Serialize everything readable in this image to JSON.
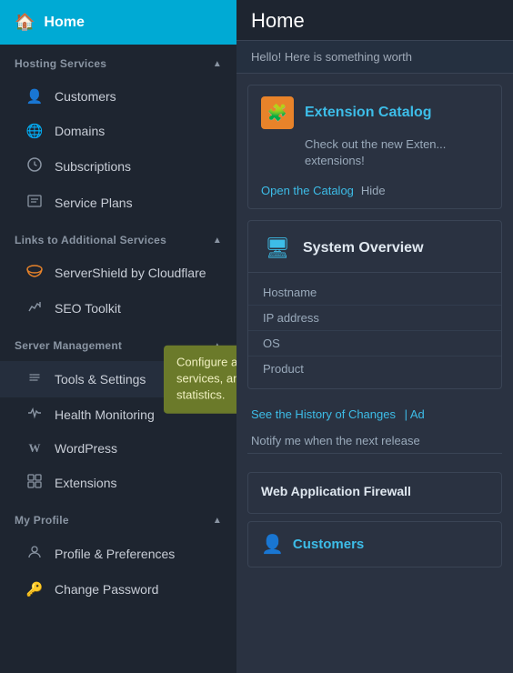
{
  "sidebar": {
    "home_label": "Home",
    "sections": [
      {
        "id": "hosting-services",
        "label": "Hosting Services",
        "items": [
          {
            "id": "customers",
            "label": "Customers",
            "icon": "👤"
          },
          {
            "id": "domains",
            "label": "Domains",
            "icon": "🌐"
          },
          {
            "id": "subscriptions",
            "label": "Subscriptions",
            "icon": "⚙"
          },
          {
            "id": "service-plans",
            "label": "Service Plans",
            "icon": "📋"
          }
        ]
      },
      {
        "id": "links-additional",
        "label": "Links to Additional Services",
        "items": [
          {
            "id": "servershield",
            "label": "ServerShield by Cloudflare",
            "icon": "☁"
          },
          {
            "id": "seo-toolkit",
            "label": "SEO Toolkit",
            "icon": "📈"
          }
        ]
      },
      {
        "id": "server-management",
        "label": "Server Management",
        "items": [
          {
            "id": "tools-settings",
            "label": "Tools & Settings",
            "icon": "🔧",
            "hovered": true,
            "tooltip": "Configure and manage system services, and view resource usage statistics."
          },
          {
            "id": "health-monitoring",
            "label": "Health Monitoring",
            "icon": "❤"
          },
          {
            "id": "wordpress",
            "label": "WordPress",
            "icon": "W"
          },
          {
            "id": "extensions",
            "label": "Extensions",
            "icon": "⊞"
          }
        ]
      },
      {
        "id": "my-profile",
        "label": "My Profile",
        "items": [
          {
            "id": "profile-preferences",
            "label": "Profile & Preferences",
            "icon": "👤"
          },
          {
            "id": "change-password",
            "label": "Change Password",
            "icon": "🔑"
          }
        ]
      }
    ]
  },
  "main": {
    "page_title": "Home",
    "notice_text": "Hello! Here is something worth",
    "catalog": {
      "title": "Extension Catalog",
      "description": "Check out the new Exten... extensions!",
      "open_label": "Open the Catalog",
      "hide_label": "Hide"
    },
    "system_overview": {
      "title": "System Overview",
      "rows": [
        {
          "label": "Hostname",
          "value": ""
        },
        {
          "label": "IP address",
          "value": ""
        },
        {
          "label": "OS",
          "value": ""
        },
        {
          "label": "Product",
          "value": ""
        }
      ]
    },
    "changes_link": "See the History of Changes",
    "changes_sep": "|",
    "changes_link2": "Ad",
    "notify_text": "Notify me when the next release",
    "waf_title": "Web Application Firewall",
    "customers_title": "Customers"
  }
}
